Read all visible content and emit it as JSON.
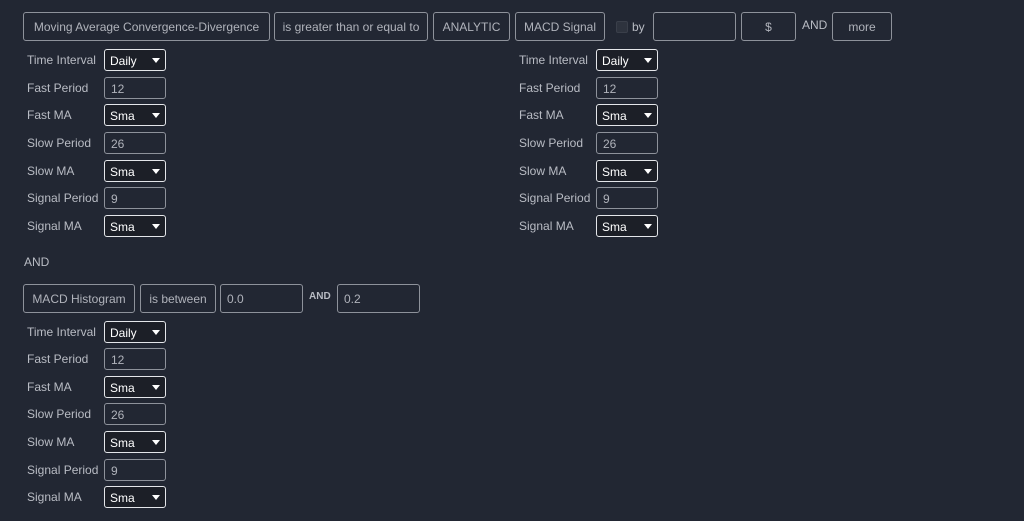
{
  "condition1": {
    "indicator": "Moving Average Convergence-Divergence",
    "operator": "is greater than or equal to",
    "type": "ANALYTIC",
    "target": "MACD Signal",
    "by_label": "by",
    "by_value": "",
    "unit": "$",
    "and_label": "AND",
    "more_label": "more",
    "left_params": {
      "time_interval": {
        "label": "Time Interval",
        "value": "Daily"
      },
      "fast_period": {
        "label": "Fast Period",
        "value": "12"
      },
      "fast_ma": {
        "label": "Fast MA",
        "value": "Sma"
      },
      "slow_period": {
        "label": "Slow Period",
        "value": "26"
      },
      "slow_ma": {
        "label": "Slow MA",
        "value": "Sma"
      },
      "signal_period": {
        "label": "Signal Period",
        "value": "9"
      },
      "signal_ma": {
        "label": "Signal MA",
        "value": "Sma"
      }
    },
    "right_params": {
      "time_interval": {
        "label": "Time Interval",
        "value": "Daily"
      },
      "fast_period": {
        "label": "Fast Period",
        "value": "12"
      },
      "fast_ma": {
        "label": "Fast MA",
        "value": "Sma"
      },
      "slow_period": {
        "label": "Slow Period",
        "value": "26"
      },
      "slow_ma": {
        "label": "Slow MA",
        "value": "Sma"
      },
      "signal_period": {
        "label": "Signal Period",
        "value": "9"
      },
      "signal_ma": {
        "label": "Signal MA",
        "value": "Sma"
      }
    }
  },
  "connector": "AND",
  "condition2": {
    "indicator": "MACD Histogram",
    "operator": "is between",
    "low": "0.0",
    "and_label": "AND",
    "high": "0.2",
    "params": {
      "time_interval": {
        "label": "Time Interval",
        "value": "Daily"
      },
      "fast_period": {
        "label": "Fast Period",
        "value": "12"
      },
      "fast_ma": {
        "label": "Fast MA",
        "value": "Sma"
      },
      "slow_period": {
        "label": "Slow Period",
        "value": "26"
      },
      "slow_ma": {
        "label": "Slow MA",
        "value": "Sma"
      },
      "signal_period": {
        "label": "Signal Period",
        "value": "9"
      },
      "signal_ma": {
        "label": "Signal MA",
        "value": "Sma"
      }
    }
  },
  "colors": {
    "background": "#222733",
    "border": "#8e929b",
    "text": "#b9bcc4",
    "select_text": "#ffffff"
  }
}
